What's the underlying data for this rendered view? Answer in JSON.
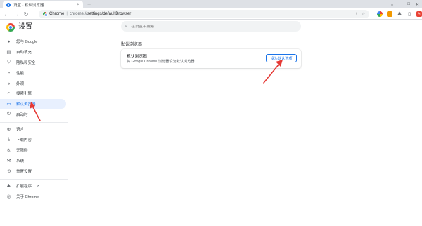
{
  "browser": {
    "tab": {
      "title": "设置 - 默认浏览器",
      "close": "×"
    },
    "new_tab": "+",
    "strip_controls": {
      "dropdown": "⌄",
      "minimize": "–",
      "maximize": "□",
      "close": "✕"
    },
    "nav": {
      "back": "←",
      "forward": "→",
      "reload": "↻"
    },
    "omnibox": {
      "site": "Chrome",
      "separator": "|",
      "scheme": "chrome://",
      "path": "settings/defaultBrowser"
    },
    "omnibox_icons": {
      "share": "⇪",
      "bookmark": "☆"
    },
    "toolbar_icons": [
      "google-icon",
      "extension-orange-icon",
      "puzzle-icon",
      "sidebar-icon",
      "profile-icon",
      "menu-icon"
    ],
    "menu": "⋮"
  },
  "header": {
    "title": "设置",
    "search_placeholder": "在设置中搜索"
  },
  "sidebar": {
    "items": [
      {
        "label": "您与 Google",
        "icon": "person-icon",
        "glyph": "👤"
      },
      {
        "label": "自动填充",
        "icon": "autofill-icon",
        "glyph": "📋"
      },
      {
        "label": "隐私和安全",
        "icon": "shield-icon",
        "glyph": "🛡"
      },
      {
        "label": "性能",
        "icon": "speedometer-icon",
        "glyph": "◔"
      },
      {
        "label": "外观",
        "icon": "palette-icon",
        "glyph": "🎨"
      },
      {
        "label": "搜索引擎",
        "icon": "search-icon",
        "glyph": "⌕"
      },
      {
        "label": "默认浏览器",
        "icon": "browser-icon",
        "glyph": "▭"
      },
      {
        "label": "启动时",
        "icon": "power-icon",
        "glyph": "⏻"
      },
      {
        "label": "语言",
        "icon": "globe-icon",
        "glyph": "🌐"
      },
      {
        "label": "下载内容",
        "icon": "download-icon",
        "glyph": "⭳"
      },
      {
        "label": "无障碍",
        "icon": "accessibility-icon",
        "glyph": "♿"
      },
      {
        "label": "系统",
        "icon": "wrench-icon",
        "glyph": "🔧"
      },
      {
        "label": "重置设置",
        "icon": "reset-icon",
        "glyph": "⟲"
      },
      {
        "label": "扩展程序",
        "icon": "puzzle-icon",
        "glyph": "✱"
      },
      {
        "label": "关于 Chrome",
        "icon": "chrome-icon",
        "glyph": "◎"
      }
    ],
    "external_glyph": "↗",
    "active_index": 6
  },
  "main": {
    "section_title": "默认浏览器",
    "card": {
      "title": "默认浏览器",
      "subtitle": "将 Google Chrome 浏览器设为默认浏览器",
      "button": "设为默认选项"
    }
  },
  "colors": {
    "accent": "#1a73e8",
    "active_bg": "#e8f0fe",
    "annotation": "#e53935"
  }
}
